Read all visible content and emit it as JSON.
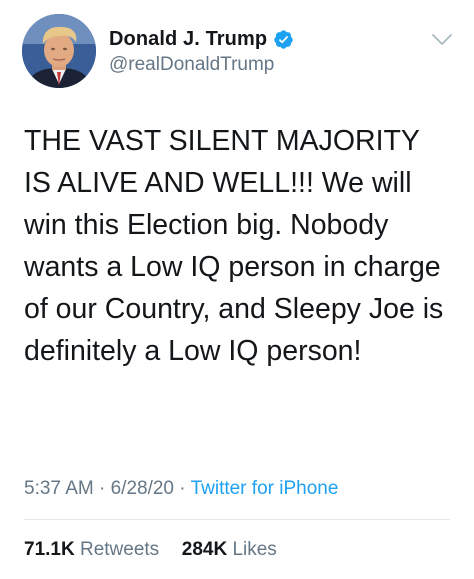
{
  "tweet": {
    "author": {
      "display_name": "Donald J. Trump",
      "handle": "@realDonaldTrump",
      "verified": true
    },
    "text": "THE VAST SILENT MAJORITY IS ALIVE AND WELL!!! We will win this Election big. Nobody wants a Low IQ person in charge of our Country, and Sleepy Joe is definitely a Low IQ person!",
    "time": "5:37 AM",
    "date": "6/28/20",
    "separator": "·",
    "source": "Twitter for iPhone",
    "retweets_count": "71.1K",
    "retweets_label": "Retweets",
    "likes_count": "284K",
    "likes_label": "Likes"
  },
  "colors": {
    "text": "#14171a",
    "secondary": "#657786",
    "link": "#1da1f2",
    "verified": "#1da1f2",
    "divider": "#e1e8ed"
  },
  "icons": {
    "verified": "verified-badge-icon",
    "menu": "chevron-down-icon"
  }
}
